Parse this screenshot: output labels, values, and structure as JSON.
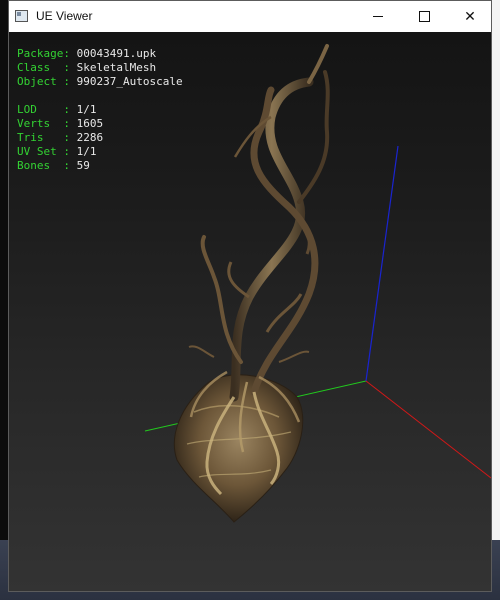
{
  "window": {
    "title": "UE Viewer",
    "minimize_symbol": "—",
    "maximize_symbol": "☐",
    "close_symbol": "✕"
  },
  "mesh_info": {
    "package_label": "Package:",
    "package_value": "00043491.upk",
    "class_label": "Class  :",
    "class_value": "SkeletalMesh",
    "object_label": "Object :",
    "object_value": "990237_Autoscale",
    "lod_label": "LOD    :",
    "lod_value": "1/1",
    "verts_label": "Verts  :",
    "verts_value": "1605",
    "tris_label": "Tris   :",
    "tris_value": "2286",
    "uvset_label": "UV Set :",
    "uvset_value": "1/1",
    "bones_label": "Bones  :",
    "bones_value": "59"
  },
  "colors": {
    "label_green": "#33d233",
    "value_white": "#e8e8e8",
    "axis_x": "#d01818",
    "axis_y": "#22c81e",
    "axis_z": "#1a24d0"
  },
  "icons": [
    "app-icon",
    "minimize-icon",
    "maximize-icon",
    "close-icon"
  ]
}
